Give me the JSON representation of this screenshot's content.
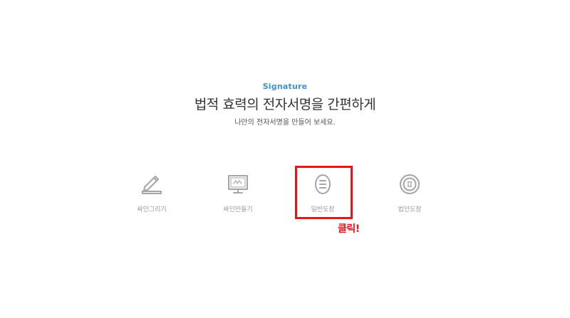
{
  "hero": {
    "eyebrow": "Signature",
    "headline": "법적 효력의 전자서명을 간편하게",
    "subline": "나만의 전자서명을 만들어 보세요."
  },
  "options": [
    {
      "label": "싸인그리기",
      "icon": "pen-draw-icon"
    },
    {
      "label": "싸인만들기",
      "icon": "monitor-sign-icon"
    },
    {
      "label": "일반도장",
      "icon": "oval-stamp-icon"
    },
    {
      "label": "법인도장",
      "icon": "round-seal-icon"
    }
  ],
  "annotation": {
    "text": "클릭!",
    "color": "#e8141b"
  },
  "colors": {
    "accent": "#3d8fd6",
    "icon": "#a5a5a5"
  }
}
